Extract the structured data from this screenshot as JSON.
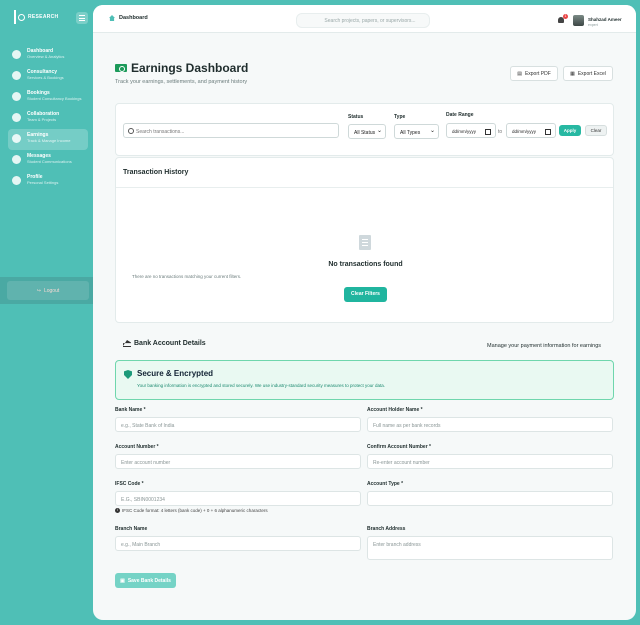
{
  "brand": {
    "name": "RESEARCH"
  },
  "sidebar": {
    "items": [
      {
        "title": "Dashboard",
        "sub": "Overview & Analytics",
        "icon": "gauge-icon"
      },
      {
        "title": "Consultancy",
        "sub": "Services & Bookings",
        "icon": "briefcase-icon"
      },
      {
        "title": "Bookings",
        "sub": "Student Consultancy Bookings",
        "icon": "calendar-icon"
      },
      {
        "title": "Collaboration",
        "sub": "Team & Projects",
        "icon": "team-icon"
      },
      {
        "title": "Earnings",
        "sub": "Track & Manage Income",
        "icon": "money-icon"
      },
      {
        "title": "Messages",
        "sub": "Student Communications",
        "icon": "chat-icon"
      },
      {
        "title": "Profile",
        "sub": "Personal Settings",
        "icon": "user-icon"
      }
    ],
    "active_index": 4,
    "logout_label": "Logout"
  },
  "topbar": {
    "breadcrumb": "Dashboard",
    "search_placeholder": "Search projects, papers, or supervisors...",
    "notification_count": "1",
    "user_name": "Shahzad Ameer",
    "user_role": "expert"
  },
  "header": {
    "title": "Earnings Dashboard",
    "subtitle": "Track your earnings, settlements, and payment history",
    "export_pdf": "Export PDF",
    "export_excel": "Export Excel"
  },
  "filters": {
    "search_placeholder": "Search transactions...",
    "status_label": "Status",
    "status_value": "All Status",
    "type_label": "Type",
    "type_value": "All Types",
    "date_label": "Date Range",
    "date_from": "dd/mm/yyyy",
    "date_to": "dd/mm/yyyy",
    "to_label": "to",
    "apply": "Apply",
    "clear": "Clear"
  },
  "transactions": {
    "title": "Transaction History",
    "empty_title": "No transactions found",
    "empty_sub": "There are no transactions matching your current filters.",
    "clear_filters": "Clear Filters"
  },
  "bank": {
    "title": "Bank Account Details",
    "manage": "Manage your payment information for earnings",
    "secure_title": "Secure & Encrypted",
    "secure_text": "Your banking information is encrypted and stored securely. We use industry-standard security measures to protect your data.",
    "fields": {
      "bank_name": {
        "label": "Bank Name *",
        "placeholder": "e.g., State Bank of India"
      },
      "holder_name": {
        "label": "Account Holder Name *",
        "placeholder": "Full name as per bank records"
      },
      "account_number": {
        "label": "Account Number *",
        "placeholder": "Enter account number"
      },
      "confirm_account": {
        "label": "Confirm Account Number *",
        "placeholder": "Re-enter account number"
      },
      "ifsc": {
        "label": "IFSC Code *",
        "placeholder": "E.G., SBIN0001234"
      },
      "account_type": {
        "label": "Account Type *",
        "placeholder": ""
      },
      "branch_name": {
        "label": "Branch Name",
        "placeholder": "e.g., Main Branch"
      },
      "branch_address": {
        "label": "Branch Address",
        "placeholder": "Enter branch address"
      }
    },
    "ifsc_hint": "IFSC Code format: 4 letters (bank code) + 0 + 6 alphanumeric characters",
    "save": "Save Bank Details"
  }
}
